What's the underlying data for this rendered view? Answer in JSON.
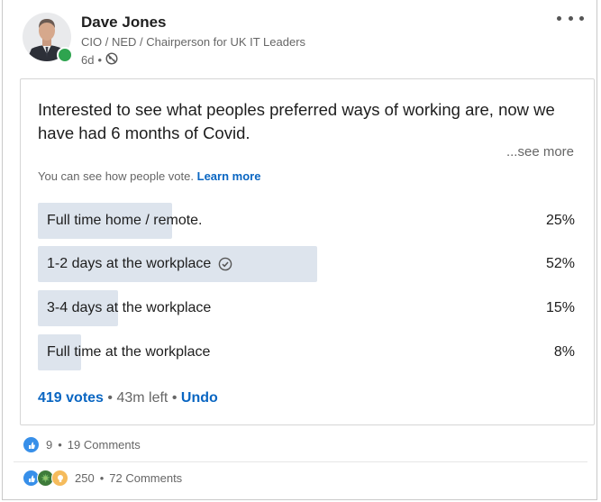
{
  "author": {
    "name": "Dave Jones",
    "title": "CIO / NED / Chairperson for UK IT Leaders",
    "time_ago": "6d",
    "separator": "•"
  },
  "poll": {
    "question": "Interested to see what peoples preferred ways of working are, now we have had 6 months of Covid.",
    "see_more": "...see more",
    "notice_text": "You can see how people vote.",
    "notice_link": "Learn more",
    "options": [
      {
        "label": "Full time home / remote.",
        "percent": "25%",
        "value": 0.25,
        "selected": false
      },
      {
        "label": "1-2 days at the workplace",
        "percent": "52%",
        "value": 0.52,
        "selected": true
      },
      {
        "label": "3-4 days at the workplace",
        "percent": "15%",
        "value": 0.15,
        "selected": false
      },
      {
        "label": "Full time at the workplace",
        "percent": "8%",
        "value": 0.08,
        "selected": false
      }
    ],
    "votes": "419 votes",
    "time_left": "43m left",
    "undo": "Undo",
    "dot": "•"
  },
  "social": {
    "row1": {
      "count": "9",
      "comments": "19 Comments"
    },
    "row2": {
      "count": "250",
      "comments": "72 Comments"
    },
    "dot": "•"
  },
  "colors": {
    "accent": "#0a66c2",
    "bar": "#dde4ed",
    "online": "#2ea44f"
  }
}
